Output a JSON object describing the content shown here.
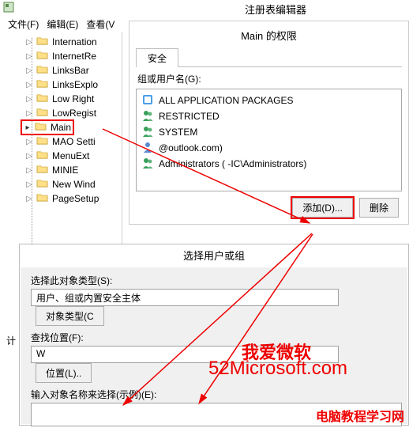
{
  "app": {
    "title": "注册表编辑器"
  },
  "menubar": {
    "file": "文件(F)",
    "edit": "编辑(E)",
    "view": "查看(V"
  },
  "tree": {
    "items": [
      {
        "label": "Internation"
      },
      {
        "label": "InternetRe"
      },
      {
        "label": "LinksBar"
      },
      {
        "label": "LinksExplo"
      },
      {
        "label": "Low Right"
      },
      {
        "label": "LowRegist"
      },
      {
        "label": "Main"
      },
      {
        "label": "MAO Setti"
      },
      {
        "label": "MenuExt"
      },
      {
        "label": "MINIE"
      },
      {
        "label": "New Wind"
      },
      {
        "label": "PageSetup"
      }
    ]
  },
  "perm": {
    "title": "Main 的权限",
    "tab_security": "安全",
    "group_label": "组或用户名(G):",
    "rows": [
      "ALL APPLICATION PACKAGES",
      "RESTRICTED",
      "SYSTEM",
      "                               @outlook.com)",
      "Administrators (              -IC\\Administrators)"
    ],
    "add_btn": "添加(D)...",
    "remove_btn": "删除"
  },
  "select": {
    "title": "选择用户或组",
    "obj_type_label": "选择此对象类型(S):",
    "obj_type_value": "用户、组或内置安全主体",
    "obj_type_btn": "对象类型(C",
    "loc_label": "查找位置(F):",
    "loc_value": "W",
    "loc_btn": "位置(L)..",
    "names_label": "输入对象名称来选择(示例)(E):"
  },
  "left_small": "计",
  "watermarks": {
    "w1": "我爱微软",
    "w2": "52Microsoft.com",
    "w3": "电脑教程学习网"
  }
}
